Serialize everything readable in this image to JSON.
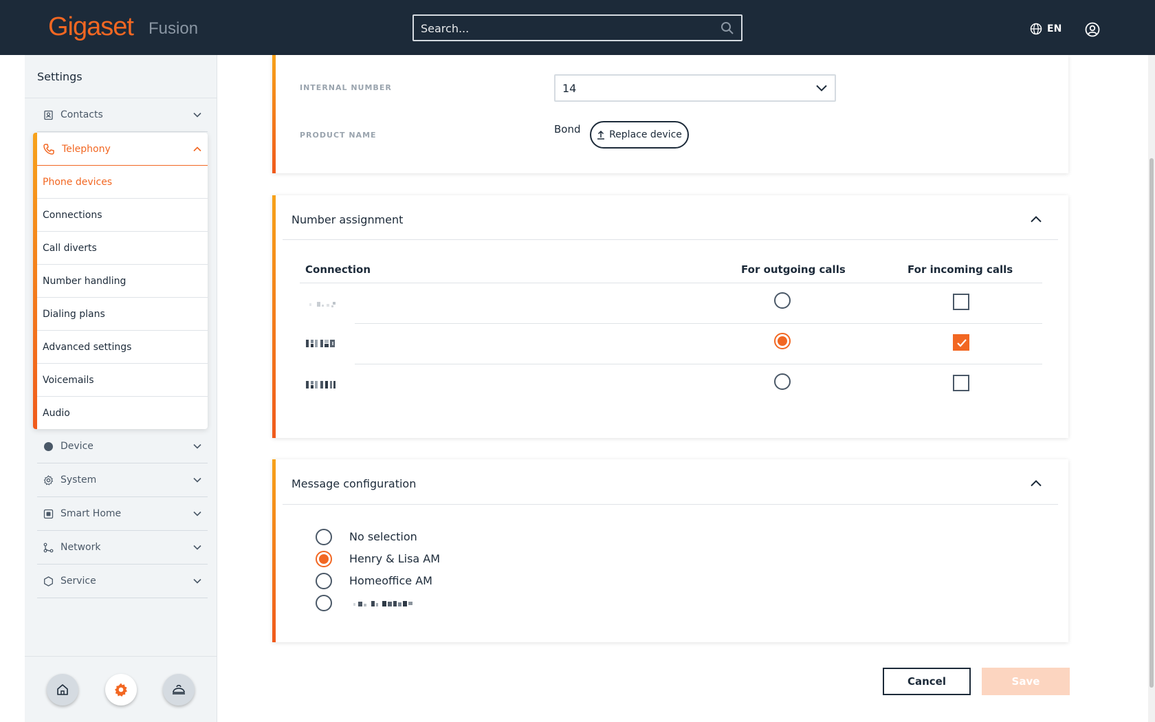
{
  "app": {
    "brand": "Gigaset",
    "product": "Fusion"
  },
  "header": {
    "search_placeholder": "Search...",
    "language": "EN"
  },
  "colors": {
    "accent": "#f26722",
    "navy": "#1c2a39",
    "save_disabled": "#fcd5c0"
  },
  "sidebar": {
    "title": "Settings",
    "items_top": [
      {
        "label": "Contacts",
        "icon": "address-book-icon"
      }
    ],
    "telephony": {
      "label": "Telephony",
      "icon": "phone-icon",
      "expanded": true,
      "sub_items": [
        {
          "label": "Phone devices",
          "active": true
        },
        {
          "label": "Connections"
        },
        {
          "label": "Call diverts"
        },
        {
          "label": "Number handling"
        },
        {
          "label": "Dialing plans"
        },
        {
          "label": "Advanced settings"
        },
        {
          "label": "Voicemails"
        },
        {
          "label": "Audio"
        }
      ]
    },
    "items_bottom": [
      {
        "label": "Device",
        "icon": "device-icon"
      },
      {
        "label": "System",
        "icon": "gear-icon"
      },
      {
        "label": "Smart Home",
        "icon": "smart-home-icon"
      },
      {
        "label": "Network",
        "icon": "network-icon"
      },
      {
        "label": "Service",
        "icon": "service-icon"
      }
    ],
    "footer_buttons": [
      {
        "icon": "home-icon"
      },
      {
        "icon": "settings-icon",
        "active": true
      },
      {
        "icon": "smart-hub-icon"
      }
    ]
  },
  "device_card": {
    "internal_number_label": "INTERNAL NUMBER",
    "internal_number_value": "14",
    "product_name_label": "PRODUCT NAME",
    "product_name_value": "Bond",
    "replace_button": "Replace device"
  },
  "number_assignment": {
    "title": "Number assignment",
    "columns": [
      "Connection",
      "For outgoing calls",
      "For incoming calls"
    ],
    "rows": [
      {
        "outgoing": false,
        "incoming": false
      },
      {
        "outgoing": true,
        "incoming": true
      },
      {
        "outgoing": false,
        "incoming": false
      }
    ]
  },
  "message_configuration": {
    "title": "Message configuration",
    "options": [
      {
        "label": "No selection",
        "selected": false
      },
      {
        "label": "Henry & Lisa AM",
        "selected": true
      },
      {
        "label": "Homeoffice AM",
        "selected": false
      },
      {
        "label": "",
        "selected": false
      }
    ]
  },
  "actions": {
    "cancel": "Cancel",
    "save": "Save"
  }
}
